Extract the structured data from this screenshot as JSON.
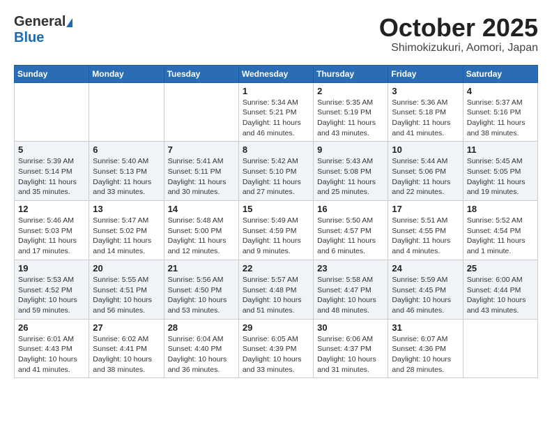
{
  "header": {
    "logo_general": "General",
    "logo_blue": "Blue",
    "month_title": "October 2025",
    "location": "Shimokizukuri, Aomori, Japan"
  },
  "days_of_week": [
    "Sunday",
    "Monday",
    "Tuesday",
    "Wednesday",
    "Thursday",
    "Friday",
    "Saturday"
  ],
  "weeks": [
    [
      {
        "day": "",
        "info": ""
      },
      {
        "day": "",
        "info": ""
      },
      {
        "day": "",
        "info": ""
      },
      {
        "day": "1",
        "info": "Sunrise: 5:34 AM\nSunset: 5:21 PM\nDaylight: 11 hours\nand 46 minutes."
      },
      {
        "day": "2",
        "info": "Sunrise: 5:35 AM\nSunset: 5:19 PM\nDaylight: 11 hours\nand 43 minutes."
      },
      {
        "day": "3",
        "info": "Sunrise: 5:36 AM\nSunset: 5:18 PM\nDaylight: 11 hours\nand 41 minutes."
      },
      {
        "day": "4",
        "info": "Sunrise: 5:37 AM\nSunset: 5:16 PM\nDaylight: 11 hours\nand 38 minutes."
      }
    ],
    [
      {
        "day": "5",
        "info": "Sunrise: 5:39 AM\nSunset: 5:14 PM\nDaylight: 11 hours\nand 35 minutes."
      },
      {
        "day": "6",
        "info": "Sunrise: 5:40 AM\nSunset: 5:13 PM\nDaylight: 11 hours\nand 33 minutes."
      },
      {
        "day": "7",
        "info": "Sunrise: 5:41 AM\nSunset: 5:11 PM\nDaylight: 11 hours\nand 30 minutes."
      },
      {
        "day": "8",
        "info": "Sunrise: 5:42 AM\nSunset: 5:10 PM\nDaylight: 11 hours\nand 27 minutes."
      },
      {
        "day": "9",
        "info": "Sunrise: 5:43 AM\nSunset: 5:08 PM\nDaylight: 11 hours\nand 25 minutes."
      },
      {
        "day": "10",
        "info": "Sunrise: 5:44 AM\nSunset: 5:06 PM\nDaylight: 11 hours\nand 22 minutes."
      },
      {
        "day": "11",
        "info": "Sunrise: 5:45 AM\nSunset: 5:05 PM\nDaylight: 11 hours\nand 19 minutes."
      }
    ],
    [
      {
        "day": "12",
        "info": "Sunrise: 5:46 AM\nSunset: 5:03 PM\nDaylight: 11 hours\nand 17 minutes."
      },
      {
        "day": "13",
        "info": "Sunrise: 5:47 AM\nSunset: 5:02 PM\nDaylight: 11 hours\nand 14 minutes."
      },
      {
        "day": "14",
        "info": "Sunrise: 5:48 AM\nSunset: 5:00 PM\nDaylight: 11 hours\nand 12 minutes."
      },
      {
        "day": "15",
        "info": "Sunrise: 5:49 AM\nSunset: 4:59 PM\nDaylight: 11 hours\nand 9 minutes."
      },
      {
        "day": "16",
        "info": "Sunrise: 5:50 AM\nSunset: 4:57 PM\nDaylight: 11 hours\nand 6 minutes."
      },
      {
        "day": "17",
        "info": "Sunrise: 5:51 AM\nSunset: 4:55 PM\nDaylight: 11 hours\nand 4 minutes."
      },
      {
        "day": "18",
        "info": "Sunrise: 5:52 AM\nSunset: 4:54 PM\nDaylight: 11 hours\nand 1 minute."
      }
    ],
    [
      {
        "day": "19",
        "info": "Sunrise: 5:53 AM\nSunset: 4:52 PM\nDaylight: 10 hours\nand 59 minutes."
      },
      {
        "day": "20",
        "info": "Sunrise: 5:55 AM\nSunset: 4:51 PM\nDaylight: 10 hours\nand 56 minutes."
      },
      {
        "day": "21",
        "info": "Sunrise: 5:56 AM\nSunset: 4:50 PM\nDaylight: 10 hours\nand 53 minutes."
      },
      {
        "day": "22",
        "info": "Sunrise: 5:57 AM\nSunset: 4:48 PM\nDaylight: 10 hours\nand 51 minutes."
      },
      {
        "day": "23",
        "info": "Sunrise: 5:58 AM\nSunset: 4:47 PM\nDaylight: 10 hours\nand 48 minutes."
      },
      {
        "day": "24",
        "info": "Sunrise: 5:59 AM\nSunset: 4:45 PM\nDaylight: 10 hours\nand 46 minutes."
      },
      {
        "day": "25",
        "info": "Sunrise: 6:00 AM\nSunset: 4:44 PM\nDaylight: 10 hours\nand 43 minutes."
      }
    ],
    [
      {
        "day": "26",
        "info": "Sunrise: 6:01 AM\nSunset: 4:43 PM\nDaylight: 10 hours\nand 41 minutes."
      },
      {
        "day": "27",
        "info": "Sunrise: 6:02 AM\nSunset: 4:41 PM\nDaylight: 10 hours\nand 38 minutes."
      },
      {
        "day": "28",
        "info": "Sunrise: 6:04 AM\nSunset: 4:40 PM\nDaylight: 10 hours\nand 36 minutes."
      },
      {
        "day": "29",
        "info": "Sunrise: 6:05 AM\nSunset: 4:39 PM\nDaylight: 10 hours\nand 33 minutes."
      },
      {
        "day": "30",
        "info": "Sunrise: 6:06 AM\nSunset: 4:37 PM\nDaylight: 10 hours\nand 31 minutes."
      },
      {
        "day": "31",
        "info": "Sunrise: 6:07 AM\nSunset: 4:36 PM\nDaylight: 10 hours\nand 28 minutes."
      },
      {
        "day": "",
        "info": ""
      }
    ]
  ]
}
